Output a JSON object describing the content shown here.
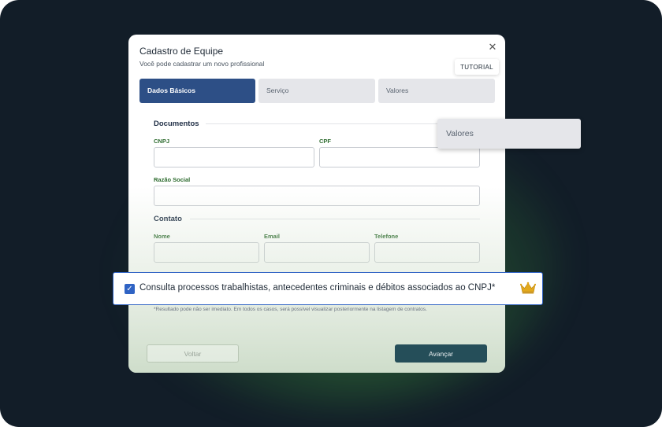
{
  "modal": {
    "title": "Cadastro de Equipe",
    "subtitle": "Você pode cadastrar um novo profissional",
    "tutorial_label": "TUTORIAL",
    "close_glyph": "✕"
  },
  "tabs": [
    {
      "label": "Dados Básicos",
      "active": true
    },
    {
      "label": "Serviço",
      "active": false
    },
    {
      "label": "Valores",
      "active": false
    }
  ],
  "popup": {
    "label": "Valores"
  },
  "sections": {
    "documentos": {
      "title": "Documentos",
      "cnpj_label": "CNPJ",
      "cpf_label": "CPF",
      "razao_label": "Razão Social"
    },
    "contato": {
      "title": "Contato",
      "nome_label": "Nome",
      "email_label": "Email",
      "telefone_label": "Telefone"
    }
  },
  "consent": {
    "checked": true,
    "check_glyph": "✓",
    "text": "Consulta processos trabalhistas, antecedentes criminais e débitos associados ao CNPJ*"
  },
  "footnote": "*Resultado pode não ser imediato. Em todos os casos, será possível visualizar posteriormente na listagem de contratos.",
  "buttons": {
    "back": "Voltar",
    "next": "Avançar"
  },
  "colors": {
    "background": "#121d28",
    "primary": "#2d4f86",
    "label_green": "#2d6b2e",
    "accent_blue": "#2f63c4",
    "next_button": "#254e59",
    "crown": "#e2a81c"
  }
}
